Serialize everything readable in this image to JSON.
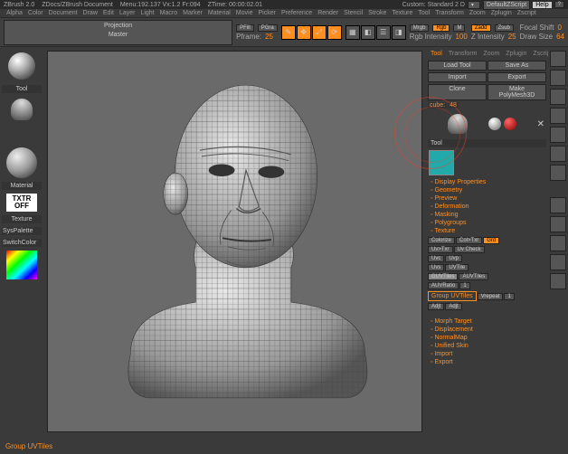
{
  "titlebar": {
    "app": "ZBrush 2.0",
    "doc": "ZDocs/ZBrush Document",
    "mem": "Menu:192.137 Vx:1.2 Fr:094",
    "time": "ZTime: 00:00:02.01",
    "custom": "Custom: Standard 2 D",
    "script": "DefaultZScript",
    "help": "Help"
  },
  "menu": [
    "Alpha",
    "Color",
    "Document",
    "Draw",
    "Edit",
    "Layer",
    "Light",
    "Macro",
    "Marker",
    "Material",
    "Movie",
    "Picker",
    "Preference",
    "Render",
    "Stencil",
    "Stroke",
    "Texture",
    "Tool",
    "Transform",
    "Zoom",
    "Zplugin",
    "Zscript"
  ],
  "top": {
    "projection": "Projection\nMaster",
    "pfill": "PFill",
    "pgra": "PGra",
    "pframe": "Pframe:",
    "pframe_v": "25",
    "mrgb": "Mrgb",
    "rgb": "Rgb",
    "m": "M",
    "zadd": "Zadd",
    "zsub": "Zsub",
    "rgb_int": "Rgb Intensity",
    "rgb_int_v": "100",
    "z_int": "Z Intensity",
    "z_int_v": "25",
    "focal": "Focal Shift",
    "focal_v": "0",
    "draw": "Draw Size",
    "draw_v": "64"
  },
  "left": {
    "tool": "Tool",
    "material": "Material",
    "txtr": "TXTR\nOFF",
    "texture": "Texture",
    "syspalette": "SysPalette",
    "switch": "SwitchColor"
  },
  "panel": {
    "load": "Load Tool",
    "saveas": "Save As",
    "import": "Import",
    "export": "Export",
    "clone": "Clone",
    "make": "Make PolyMesh3D",
    "cube": "cube:",
    "cube_v": "48",
    "tool_lbl": "Tool",
    "sections": [
      "Display Properties",
      "Geometry",
      "Preview",
      "Deformation",
      "Masking",
      "Polygroups",
      "Texture"
    ],
    "colorize": "Colorize",
    "col_txr": "Col>Txr",
    "grd": "Grd",
    "uv_txr": "Uv>Txr",
    "uv_check": "Uv Check",
    "uvc": "Uvc",
    "uvp": "Uvp",
    "uvs": "Uvs",
    "uvtile": "UVTile",
    "guvtiles": "GUVTiles",
    "auvtiles": "AUVTiles",
    "auvratio": "AUVRatio",
    "auvratio_v": "1",
    "group_uv": "Group UVTiles",
    "vrepeat": "Vrepeat",
    "vrepeat_v": "1",
    "adj1": "Adjt",
    "adj2": "Adjt",
    "lower": [
      "Morph Target",
      "Displacement",
      "NormalMap",
      "Unified Skin",
      "Import",
      "Export"
    ]
  },
  "tabs": [
    "Tool",
    "Transform",
    "Zoom",
    "Zplugin",
    "Zscript"
  ],
  "status": "Group UVTiles"
}
